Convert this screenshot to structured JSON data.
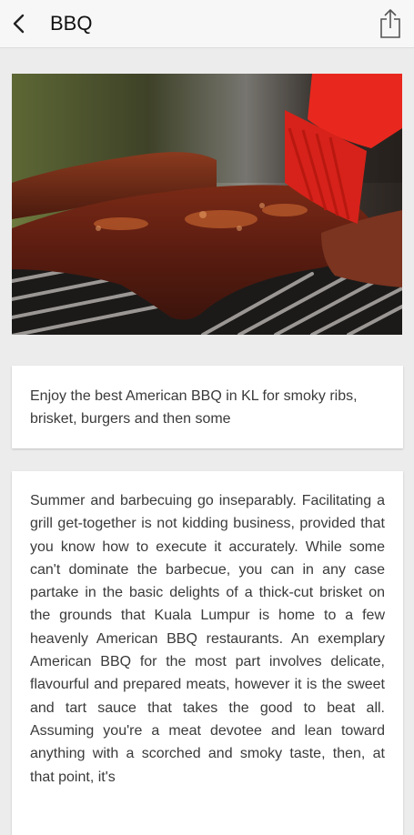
{
  "header": {
    "title": "BBQ",
    "back_icon": "chevron-left-icon",
    "share_icon": "share-icon"
  },
  "hero": {
    "image": "bbq-ribs-photo",
    "brush_color": "#e8281e"
  },
  "intro": {
    "text": "Enjoy the best American BBQ in KL for smoky ribs, brisket, burgers and then some"
  },
  "article": {
    "text": "Summer and barbecuing go inseparably. Facilitating a grill get-together is not kidding business, provided that you know how to execute it accurately. While some can't dominate the barbecue, you can in any case partake in the basic delights of a thick-cut brisket on the grounds that Kuala Lumpur is home to a few heavenly American BBQ restaurants. An exemplary American BBQ for the most part involves delicate, flavourful and prepared meats, however it is the sweet and tart sauce that takes the good to beat all. Assuming you're a meat devotee and lean toward anything with a scorched and smoky taste, then, at that point, it's"
  }
}
